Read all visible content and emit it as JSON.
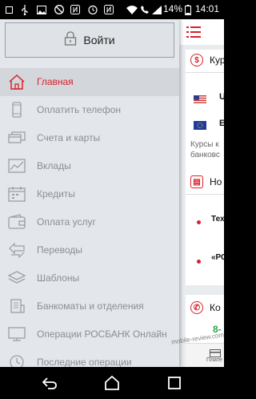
{
  "status_bar": {
    "battery_percent": "14%",
    "time": "14:01",
    "icons": [
      "square-icon",
      "usb-icon",
      "image-icon",
      "do-not-disturb-icon",
      "nfc-icon",
      "alarm-icon",
      "wifi-icon",
      "phone-icon",
      "signal-icon",
      "battery-icon"
    ]
  },
  "drawer": {
    "login_label": "Войти",
    "items": [
      {
        "label": "Главная",
        "icon": "home-icon",
        "active": true
      },
      {
        "label": "Оплатить телефон",
        "icon": "phone-icon",
        "active": false
      },
      {
        "label": "Счета и карты",
        "icon": "cards-icon",
        "active": false
      },
      {
        "label": "Вклады",
        "icon": "chart-icon",
        "active": false
      },
      {
        "label": "Кредиты",
        "icon": "calendar-icon",
        "active": false
      },
      {
        "label": "Оплата услуг",
        "icon": "wallet-icon",
        "active": false
      },
      {
        "label": "Переводы",
        "icon": "transfer-icon",
        "active": false
      },
      {
        "label": "Шаблоны",
        "icon": "layers-icon",
        "active": false
      },
      {
        "label": "Банкоматы и отделения",
        "icon": "bank-icon",
        "active": false
      },
      {
        "label": "Операции РОСБАНК Онлайн",
        "icon": "desktop-icon",
        "active": false
      },
      {
        "label": "Последние операции",
        "icon": "clock-icon",
        "active": false
      }
    ]
  },
  "background": {
    "rates_title": "Кур",
    "usd_code": "U",
    "eur_code": "E",
    "rates_note_1": "Курсы к",
    "rates_note_2": "банковс",
    "news_title": "Но",
    "news_1": "Тех",
    "news_2": "«РС",
    "contacts_title": "Ко",
    "phone_partial": "8-",
    "tab_label": "Плате"
  },
  "watermark": "mobile-review.com",
  "colors": {
    "accent": "#d8202a",
    "drawer_bg": "#e3e6ea",
    "inactive_text": "#8a8f96"
  }
}
